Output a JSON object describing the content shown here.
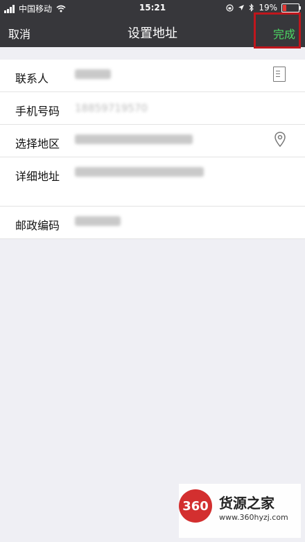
{
  "status": {
    "carrier": "中国移动",
    "time": "15:21",
    "battery": "19%",
    "battery_level": 0.19
  },
  "nav": {
    "back": "取消",
    "title": "设置地址",
    "done": "完成"
  },
  "form": {
    "contact_label": "联系人",
    "contact_value": "",
    "phone_label": "手机号码",
    "phone_value": "18859719570",
    "region_label": "选择地区",
    "region_value": "",
    "address_label": "详细地址",
    "address_value": "",
    "zip_label": "邮政编码",
    "zip_value": ""
  },
  "watermark": {
    "badge": "360",
    "site_name": "货源之家",
    "url": "www.360hyzj.com"
  }
}
